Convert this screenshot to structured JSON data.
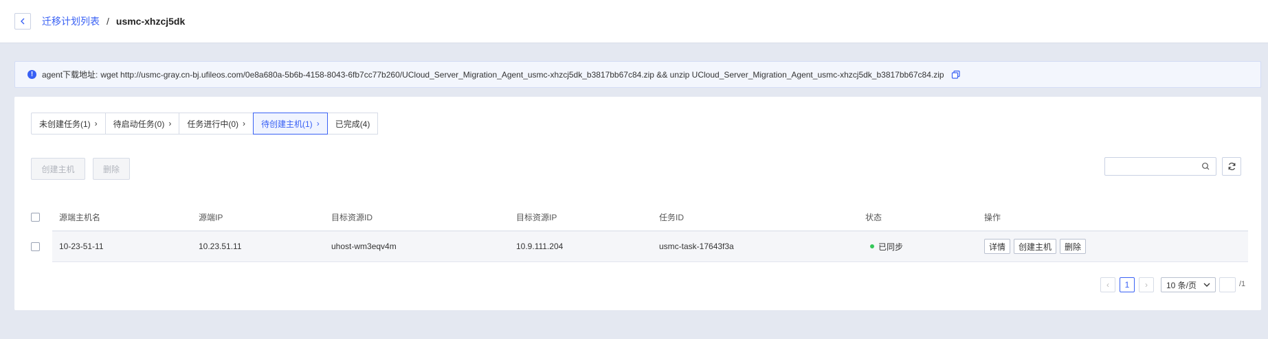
{
  "header": {
    "back_icon": "chevron-left-icon",
    "breadcrumb_link": "迁移计划列表",
    "separator": "/",
    "current": "usmc-xhzcj5dk"
  },
  "notice": {
    "icon": "info-icon",
    "label": "agent下载地址:",
    "text": "wget http://usmc-gray.cn-bj.ufileos.com/0e8a680a-5b6b-4158-8043-6fb7cc77b260/UCloud_Server_Migration_Agent_usmc-xhzcj5dk_b3817bb67c84.zip && unzip UCloud_Server_Migration_Agent_usmc-xhzcj5dk_b3817bb67c84.zip",
    "copy_icon": "copy-icon"
  },
  "tabs": [
    {
      "label": "未创建任务(1)",
      "active": false
    },
    {
      "label": "待启动任务(0)",
      "active": false
    },
    {
      "label": "任务进行中(0)",
      "active": false
    },
    {
      "label": "待创建主机(1)",
      "active": true
    },
    {
      "label": "已完成(4)",
      "active": false
    }
  ],
  "toolbar": {
    "create_label": "创建主机",
    "delete_label": "删除"
  },
  "table": {
    "columns": [
      "源端主机名",
      "源端IP",
      "目标资源ID",
      "目标资源IP",
      "任务ID",
      "状态",
      "操作"
    ],
    "rows": [
      {
        "hostname": "10-23-51-11",
        "source_ip": "10.23.51.11",
        "target_id": "uhost-wm3eqv4m",
        "target_ip": "10.9.111.204",
        "task_id": "usmc-task-17643f3a",
        "status": "已同步",
        "status_color": "#34c759",
        "actions": [
          "详情",
          "创建主机",
          "删除"
        ]
      }
    ]
  },
  "pagination": {
    "prev_icon": "chevron-left-icon",
    "current_page": "1",
    "next_icon": "chevron-right-icon",
    "page_size": "10 条/页",
    "total_pages": "/1"
  },
  "colors": {
    "accent": "#3860f4",
    "background": "#e4e8f1"
  }
}
